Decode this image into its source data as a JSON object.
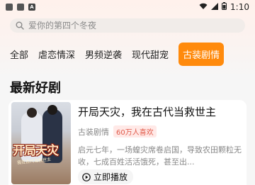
{
  "status_bar": {
    "time": "1:10",
    "left_icons": [
      "app-icon",
      "app-icon",
      "a-icon"
    ],
    "right_icons": [
      "wifi-icon",
      "signal-icon",
      "battery-icon"
    ]
  },
  "search": {
    "placeholder": "爱你的第四个冬夜"
  },
  "tabs": [
    {
      "label": "全部"
    },
    {
      "label": "虐恋情深"
    },
    {
      "label": "男频逆袭"
    },
    {
      "label": "现代甜宠"
    },
    {
      "label": "古装剧情",
      "active": true
    }
  ],
  "section": {
    "title": "最新好剧"
  },
  "drama": {
    "title": "开局天灾，我在古代当救世主",
    "genre": "古装剧情",
    "badge": "60万人喜欢",
    "description": "启元七年，一场蝗灾席卷启国，导致农田颗粒无收，七成百姓活活饿死，甚至出...",
    "play_label": "立即播放",
    "cover_title": "开局天灾",
    "cover_subtitle": "我在古代当救世主"
  },
  "colors": {
    "accent": "#ff8a0c",
    "badge_bg": "#ffe9e7",
    "badge_text": "#e05a4a"
  }
}
